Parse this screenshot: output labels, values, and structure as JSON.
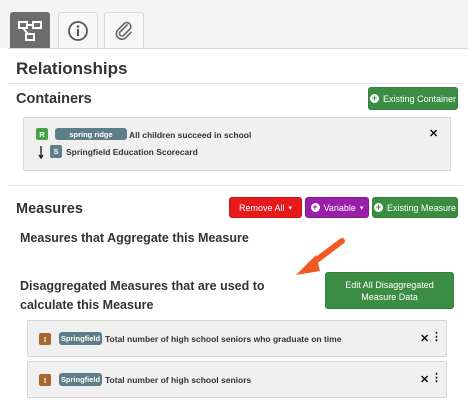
{
  "tabs": [
    {
      "name": "relationships",
      "icon": "hierarchy-icon",
      "active": true
    },
    {
      "name": "info",
      "icon": "info-icon",
      "active": false
    },
    {
      "name": "attachments",
      "icon": "paperclip-icon",
      "active": false
    }
  ],
  "page_title": "Relationships",
  "containers": {
    "heading": "Containers",
    "add_button": "Existing Container",
    "item": {
      "type_badge": "R",
      "tag": "spring ridge",
      "title": "All children succeed in school",
      "child_badge": "S",
      "child_title": "Springfield Education Scorecard"
    }
  },
  "measures": {
    "heading": "Measures",
    "remove_all_button": "Remove All",
    "variable_button": "Variable",
    "existing_measure_button": "Existing Measure",
    "aggregate_heading": "Measures that Aggregate this Measure",
    "disaggregated_heading": "Disaggregated Measures that are used to calculate this Measure",
    "edit_all_button": "Edit All Disaggregated Measure Data",
    "items": [
      {
        "badge": "I",
        "tag": "Springfield",
        "title": "Total number of high school seniors who graduate on time"
      },
      {
        "badge": "I",
        "tag": "Springfield",
        "title": "Total number of high school seniors"
      }
    ]
  },
  "colors": {
    "green": "#3c8d44",
    "red": "#e6191b",
    "purple": "#9a1fa8",
    "tag_slate": "#5d7e86",
    "badge_brown": "#a8662b",
    "arrow_orange": "#f05a22"
  }
}
